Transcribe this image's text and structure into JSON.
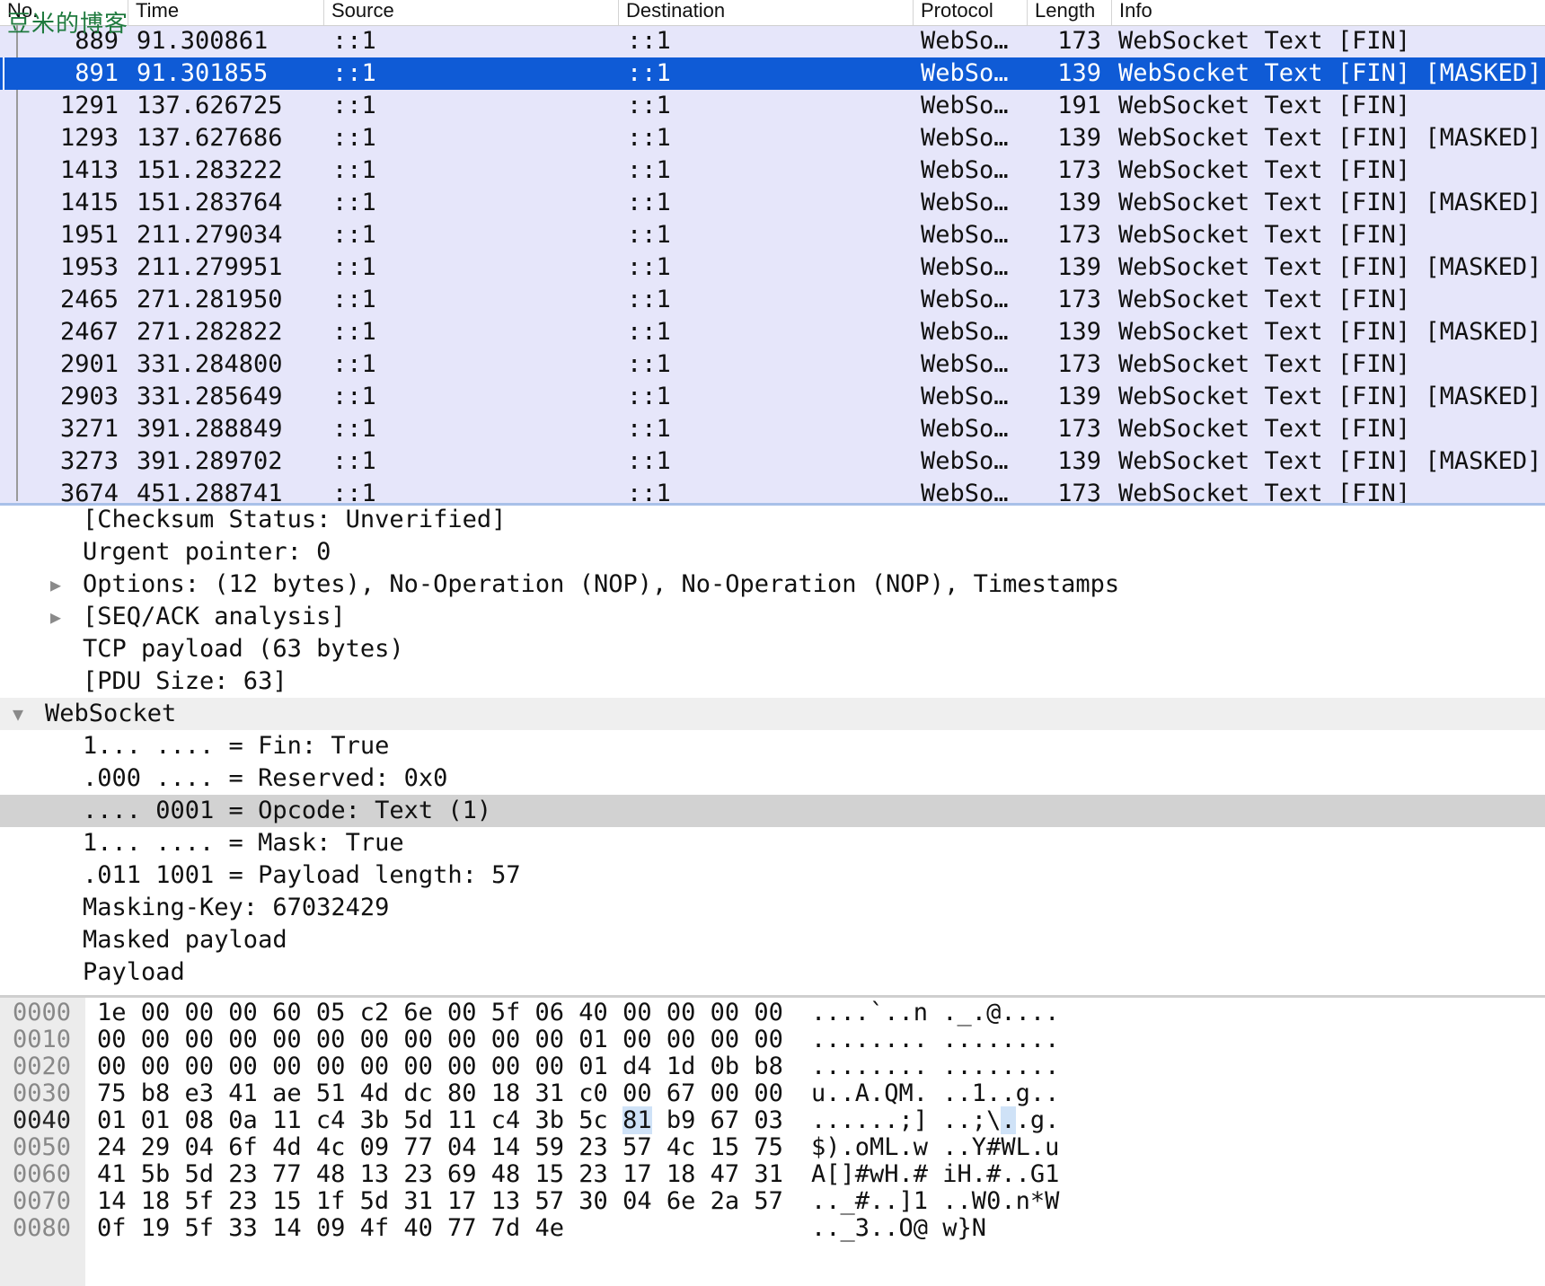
{
  "watermark": "豆米的博客",
  "columns": {
    "no": "No.",
    "time": "Time",
    "source": "Source",
    "destination": "Destination",
    "protocol": "Protocol",
    "length": "Length",
    "info": "Info"
  },
  "packets": [
    {
      "no": "889",
      "time": "91.300861",
      "src": "::1",
      "dst": "::1",
      "proto": "WebSo…",
      "len": "173",
      "info": "WebSocket Text [FIN]"
    },
    {
      "no": "891",
      "time": "91.301855",
      "src": "::1",
      "dst": "::1",
      "proto": "WebSo…",
      "len": "139",
      "info": "WebSocket Text [FIN] [MASKED]"
    },
    {
      "no": "1291",
      "time": "137.626725",
      "src": "::1",
      "dst": "::1",
      "proto": "WebSo…",
      "len": "191",
      "info": "WebSocket Text [FIN]"
    },
    {
      "no": "1293",
      "time": "137.627686",
      "src": "::1",
      "dst": "::1",
      "proto": "WebSo…",
      "len": "139",
      "info": "WebSocket Text [FIN] [MASKED]"
    },
    {
      "no": "1413",
      "time": "151.283222",
      "src": "::1",
      "dst": "::1",
      "proto": "WebSo…",
      "len": "173",
      "info": "WebSocket Text [FIN]"
    },
    {
      "no": "1415",
      "time": "151.283764",
      "src": "::1",
      "dst": "::1",
      "proto": "WebSo…",
      "len": "139",
      "info": "WebSocket Text [FIN] [MASKED]"
    },
    {
      "no": "1951",
      "time": "211.279034",
      "src": "::1",
      "dst": "::1",
      "proto": "WebSo…",
      "len": "173",
      "info": "WebSocket Text [FIN]"
    },
    {
      "no": "1953",
      "time": "211.279951",
      "src": "::1",
      "dst": "::1",
      "proto": "WebSo…",
      "len": "139",
      "info": "WebSocket Text [FIN] [MASKED]"
    },
    {
      "no": "2465",
      "time": "271.281950",
      "src": "::1",
      "dst": "::1",
      "proto": "WebSo…",
      "len": "173",
      "info": "WebSocket Text [FIN]"
    },
    {
      "no": "2467",
      "time": "271.282822",
      "src": "::1",
      "dst": "::1",
      "proto": "WebSo…",
      "len": "139",
      "info": "WebSocket Text [FIN] [MASKED]"
    },
    {
      "no": "2901",
      "time": "331.284800",
      "src": "::1",
      "dst": "::1",
      "proto": "WebSo…",
      "len": "173",
      "info": "WebSocket Text [FIN]"
    },
    {
      "no": "2903",
      "time": "331.285649",
      "src": "::1",
      "dst": "::1",
      "proto": "WebSo…",
      "len": "139",
      "info": "WebSocket Text [FIN] [MASKED]"
    },
    {
      "no": "3271",
      "time": "391.288849",
      "src": "::1",
      "dst": "::1",
      "proto": "WebSo…",
      "len": "173",
      "info": "WebSocket Text [FIN]"
    },
    {
      "no": "3273",
      "time": "391.289702",
      "src": "::1",
      "dst": "::1",
      "proto": "WebSo…",
      "len": "139",
      "info": "WebSocket Text [FIN] [MASKED]"
    },
    {
      "no": "3674",
      "time": "451.288741",
      "src": "::1",
      "dst": "::1",
      "proto": "WebSo…",
      "len": "173",
      "info": "WebSocket Text [FIN]"
    }
  ],
  "details": [
    "[Checksum Status: Unverified]",
    "Urgent pointer: 0",
    "Options: (12 bytes), No-Operation (NOP), No-Operation (NOP), Timestamps",
    "[SEQ/ACK analysis]",
    "TCP payload (63 bytes)",
    "[PDU Size: 63]",
    "WebSocket",
    "1... .... = Fin: True",
    ".000 .... = Reserved: 0x0",
    ".... 0001 = Opcode: Text (1)",
    "1... .... = Mask: True",
    ".011 1001 = Payload length: 57",
    "Masking-Key: 67032429",
    "Masked payload",
    "Payload"
  ],
  "bytes": [
    {
      "off": "0000",
      "hex1": "1e 00 00 00 60 05 c2 6e",
      "hex2": "00 5f 06 40 00 00 00 00",
      "ascii": "....`..n ._.@...."
    },
    {
      "off": "0010",
      "hex1": "00 00 00 00 00 00 00 00",
      "hex2": "00 00 00 01 00 00 00 00",
      "ascii": "........ ........"
    },
    {
      "off": "0020",
      "hex1": "00 00 00 00 00 00 00 00",
      "hex2": "00 00 00 01 d4 1d 0b b8",
      "ascii": "........ ........"
    },
    {
      "off": "0030",
      "hex1": "75 b8 e3 41 ae 51 4d dc",
      "hex2": "80 18 31 c0 00 67 00 00",
      "ascii": "u..A.QM. ..1..g.."
    },
    {
      "off": "0040",
      "hex1": "01 01 08 0a 11 c4 3b 5d",
      "hex2": "11 c4 3b 5c 81 b9 67 03",
      "ascii": "......;] ..;\\..g."
    },
    {
      "off": "0050",
      "hex1": "24 29 04 6f 4d 4c 09 77",
      "hex2": "04 14 59 23 57 4c 15 75",
      "ascii": "$).oML.w ..Y#WL.u"
    },
    {
      "off": "0060",
      "hex1": "41 5b 5d 23 77 48 13 23",
      "hex2": "69 48 15 23 17 18 47 31",
      "ascii": "A[]#wH.# iH.#..G1"
    },
    {
      "off": "0070",
      "hex1": "14 18 5f 23 15 1f 5d 31",
      "hex2": "17 13 57 30 04 6e 2a 57",
      "ascii": ".._#..]1 ..W0.n*W"
    },
    {
      "off": "0080",
      "hex1": "0f 19 5f 33 14 09 4f 40",
      "hex2": "77 7d 4e",
      "ascii": ".._3..O@ w}N"
    }
  ]
}
